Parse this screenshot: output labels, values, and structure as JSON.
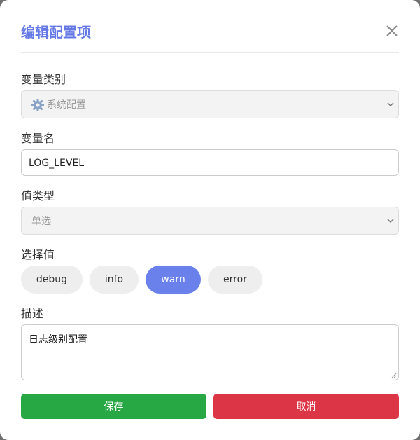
{
  "modal": {
    "title": "编辑配置项",
    "close_icon": "close-icon"
  },
  "form": {
    "category": {
      "label": "变量类别",
      "value": "系统配置",
      "icon": "gear-icon",
      "disabled": true
    },
    "name": {
      "label": "变量名",
      "value": "LOG_LEVEL"
    },
    "value_type": {
      "label": "值类型",
      "value": "单选",
      "disabled": true
    },
    "choice": {
      "label": "选择值",
      "options": [
        "debug",
        "info",
        "warn",
        "error"
      ],
      "selected": "warn"
    },
    "description": {
      "label": "描述",
      "value": "日志级别配置"
    }
  },
  "actions": {
    "save_label": "保存",
    "cancel_label": "取消"
  },
  "colors": {
    "title": "#6478e6",
    "selected_chip": "#6a80ea",
    "save": "#28a745",
    "cancel": "#dc3545"
  }
}
